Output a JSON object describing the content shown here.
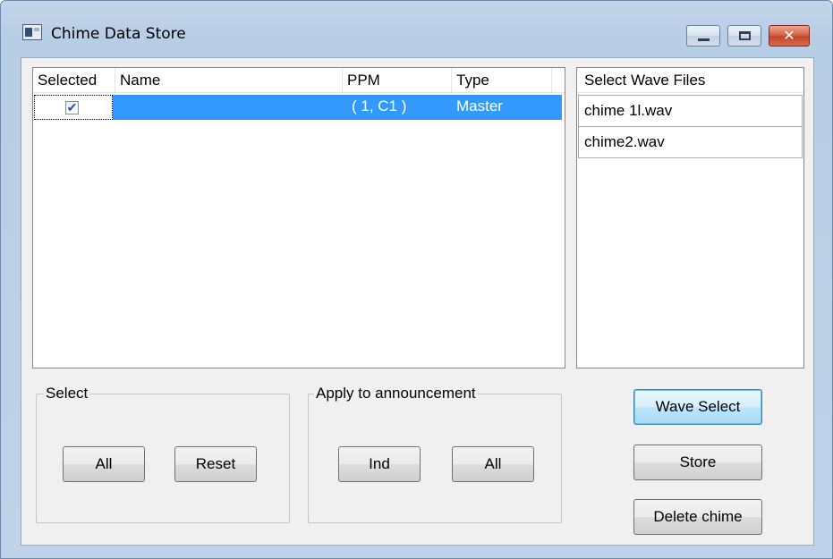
{
  "window": {
    "title": "Chime Data Store",
    "close_glyph": "✕"
  },
  "listview": {
    "columns": [
      "Selected",
      "Name",
      "PPM",
      "Type"
    ],
    "rows": [
      {
        "selected": true,
        "check_glyph": "✔",
        "name": "",
        "ppm": "( 1, C1 )",
        "type": "Master"
      }
    ]
  },
  "wave_files": {
    "header": "Select Wave Files",
    "items": [
      "chime 1l.wav",
      "chime2.wav"
    ]
  },
  "select_group": {
    "label": "Select",
    "all_label": "All",
    "reset_label": "Reset"
  },
  "apply_group": {
    "label": "Apply to announcement",
    "ind_label": "Ind",
    "all_label": "All"
  },
  "actions": {
    "wave_select_label": "Wave Select",
    "store_label": "Store",
    "delete_label": "Delete chime"
  },
  "colors": {
    "selection": "#3399ff",
    "close_button": "#c2442a"
  },
  "icons": {
    "app": "app-window-icon",
    "minimize": "minimize-icon",
    "maximize": "maximize-icon",
    "close": "close-icon",
    "check": "checkmark-icon"
  }
}
